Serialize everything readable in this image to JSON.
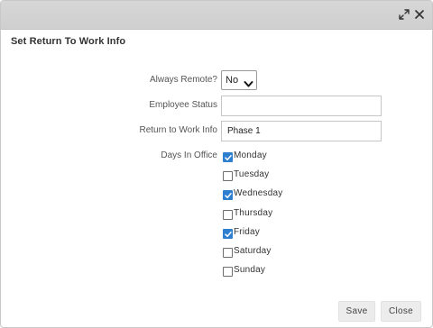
{
  "dialog": {
    "title": "Set Return To Work Info"
  },
  "titlebar": {
    "expand_icon": "expand-icon",
    "close_icon": "close-icon"
  },
  "form": {
    "always_remote": {
      "label": "Always Remote?",
      "value": "No"
    },
    "employee_status": {
      "label": "Employee Status",
      "value": ""
    },
    "return_to_work_info": {
      "label": "Return to Work Info",
      "value": "Phase 1"
    },
    "days_in_office": {
      "label": "Days In Office",
      "days": [
        {
          "label": "Monday",
          "checked": true
        },
        {
          "label": "Tuesday",
          "checked": false
        },
        {
          "label": "Wednesday",
          "checked": true
        },
        {
          "label": "Thursday",
          "checked": false
        },
        {
          "label": "Friday",
          "checked": true
        },
        {
          "label": "Saturday",
          "checked": false
        },
        {
          "label": "Sunday",
          "checked": false
        }
      ]
    }
  },
  "buttons": {
    "save": "Save",
    "close": "Close"
  },
  "colors": {
    "checkbox_checked": "#2f7fd1",
    "titlebar": "#d3d3d3"
  }
}
